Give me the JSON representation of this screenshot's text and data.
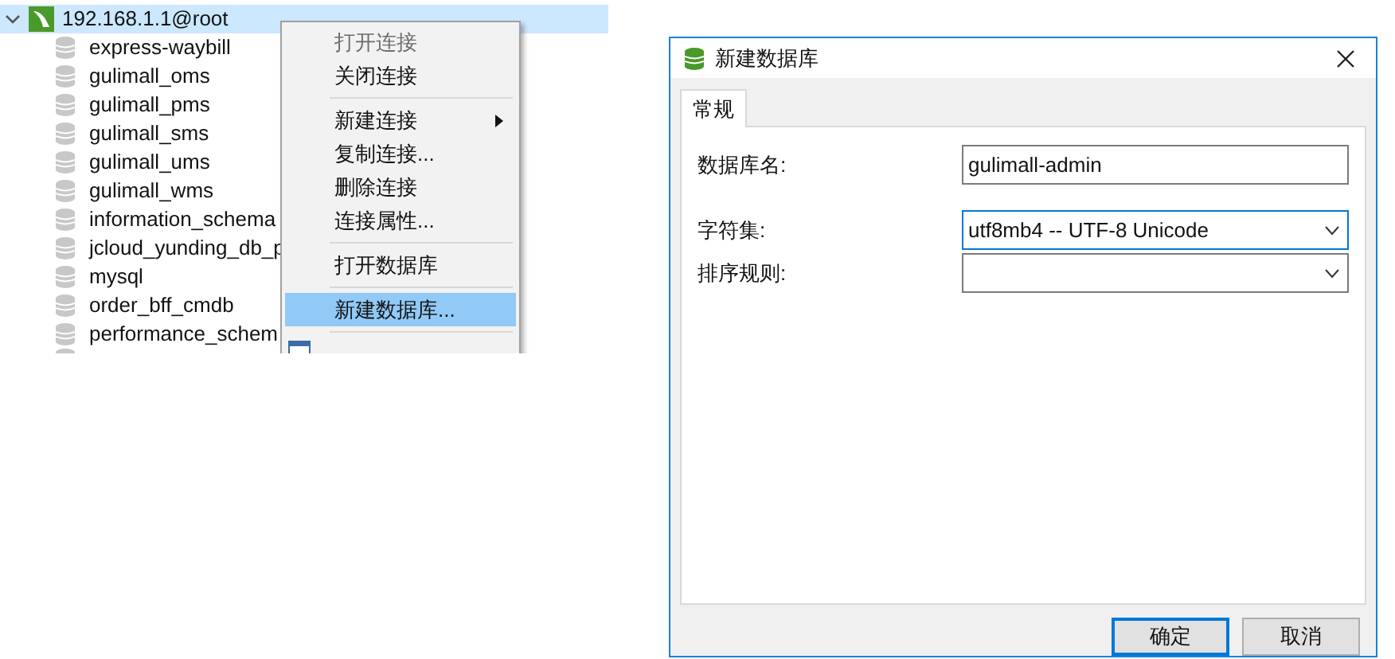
{
  "tree": {
    "connection": {
      "label": "192.168.1.1@root",
      "expanded": true,
      "selected": true
    },
    "databases": [
      {
        "label": "express-waybill"
      },
      {
        "label": "gulimall_oms"
      },
      {
        "label": "gulimall_pms"
      },
      {
        "label": "gulimall_sms"
      },
      {
        "label": "gulimall_ums"
      },
      {
        "label": "gulimall_wms"
      },
      {
        "label": "information_schema"
      },
      {
        "label": "jcloud_yunding_db_p"
      },
      {
        "label": "mysql"
      },
      {
        "label": "order_bff_cmdb"
      },
      {
        "label": "performance_schem"
      }
    ]
  },
  "context_menu": {
    "items": [
      {
        "kind": "item",
        "label": "打开连接",
        "disabled": true,
        "selected": false,
        "submenu": false
      },
      {
        "kind": "item",
        "label": "关闭连接",
        "disabled": false,
        "selected": false,
        "submenu": false
      },
      {
        "kind": "separator"
      },
      {
        "kind": "item",
        "label": "新建连接",
        "disabled": false,
        "selected": false,
        "submenu": true
      },
      {
        "kind": "item",
        "label": "复制连接...",
        "disabled": false,
        "selected": false,
        "submenu": false
      },
      {
        "kind": "item",
        "label": "删除连接",
        "disabled": false,
        "selected": false,
        "submenu": false
      },
      {
        "kind": "item",
        "label": "连接属性...",
        "disabled": false,
        "selected": false,
        "submenu": false
      },
      {
        "kind": "separator"
      },
      {
        "kind": "item",
        "label": "打开数据库",
        "disabled": false,
        "selected": false,
        "submenu": false
      },
      {
        "kind": "separator"
      },
      {
        "kind": "item",
        "label": "新建数据库...",
        "disabled": false,
        "selected": true,
        "submenu": false
      },
      {
        "kind": "separator"
      }
    ]
  },
  "dialog": {
    "title": "新建数据库",
    "tabs": [
      {
        "label": "常规",
        "selected": true
      }
    ],
    "fields": [
      {
        "label": "数据库名:",
        "kind": "text",
        "value": "gulimall-admin",
        "focused": false
      },
      {
        "label": "字符集:",
        "kind": "select",
        "value": "utf8mb4 -- UTF-8 Unicode",
        "focused": true
      },
      {
        "label": "排序规则:",
        "kind": "select",
        "focused": false
      }
    ],
    "buttons": [
      {
        "label": "确定",
        "default": true
      },
      {
        "label": "取消",
        "default": false
      }
    ]
  }
}
